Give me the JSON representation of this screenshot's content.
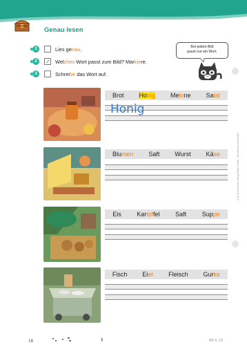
{
  "title": "Genau lesen",
  "instructions": [
    {
      "num": "1",
      "parts": [
        "Lies ge",
        "nau",
        "."
      ]
    },
    {
      "num": "2",
      "parts": [
        "Wel",
        "ches",
        " Wort passt zum Bild? Mar",
        "kie",
        "re."
      ]
    },
    {
      "num": "3",
      "parts": [
        "Schrei",
        "be",
        " das Wort auf."
      ]
    }
  ],
  "bubble": {
    "line1": "Bei jedem Bild",
    "line2": "passt nur ein Wort."
  },
  "exercises": [
    {
      "words": [
        {
          "parts": [
            "Brot"
          ],
          "highlight": false
        },
        {
          "parts": [
            "Ho",
            "nig"
          ],
          "highlight": true
        },
        {
          "parts": [
            "Me",
            "lo",
            "ne"
          ],
          "highlight": false
        },
        {
          "parts": [
            "Sa",
            "lat"
          ],
          "highlight": false
        }
      ],
      "answer": "Honig"
    },
    {
      "words": [
        {
          "parts": [
            "Blu",
            "men"
          ],
          "highlight": false
        },
        {
          "parts": [
            "Saft"
          ],
          "highlight": false
        },
        {
          "parts": [
            "Wurst"
          ],
          "highlight": false
        },
        {
          "parts": [
            "Kä",
            "se"
          ],
          "highlight": false
        }
      ],
      "answer": ""
    },
    {
      "words": [
        {
          "parts": [
            "Eis"
          ],
          "highlight": false
        },
        {
          "parts": [
            "Kar",
            "tof",
            "fel"
          ],
          "highlight": false
        },
        {
          "parts": [
            "Saft"
          ],
          "highlight": false
        },
        {
          "parts": [
            "Sup",
            "pe"
          ],
          "highlight": false
        }
      ],
      "answer": ""
    },
    {
      "words": [
        {
          "parts": [
            "Fisch"
          ],
          "highlight": false
        },
        {
          "parts": [
            "Ei",
            "er"
          ],
          "highlight": false
        },
        {
          "parts": [
            "Fleisch"
          ],
          "highlight": false
        },
        {
          "parts": [
            "Gur",
            "ke"
          ],
          "highlight": false
        }
      ],
      "answer": ""
    }
  ],
  "footer": {
    "page_number": "16",
    "ref": "BB S. 29"
  },
  "copyright": "© 2018 Cornelsen Verlag GmbH, Berlin · Alle Rechte vorbehalten.",
  "colors": {
    "teal": "#1a9c8a",
    "accent": "#2bb39e",
    "orange_syllable": "#f07e1a",
    "highlight": "#ffe200",
    "word_box": "#e2e2e2",
    "handwriting": "#3f78c0"
  },
  "icons": {
    "header": "treasure-chest-icon",
    "task2": "pencil-icon",
    "mascot": "cat-icon"
  }
}
